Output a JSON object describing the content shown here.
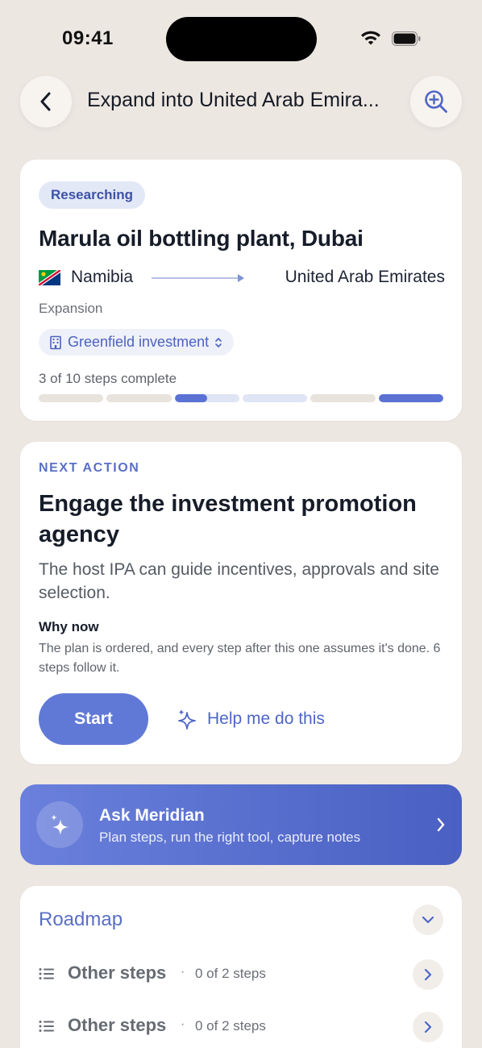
{
  "status_bar": {
    "time": "09:41"
  },
  "header": {
    "title": "Expand into United Arab Emira..."
  },
  "project": {
    "status_badge": "Researching",
    "title": "Marula oil bottling plant, Dubai",
    "origin": "Namibia",
    "destination": "United Arab Emirates",
    "type": "Expansion",
    "mode": "Greenfield investment",
    "progress_label": "3 of 10 steps complete",
    "progress": {
      "completed": 3,
      "total": 10
    }
  },
  "next_action": {
    "eyebrow": "NEXT ACTION",
    "title": "Engage the investment promotion agency",
    "description": "The host IPA can guide incentives, approvals and site selection.",
    "why_label": "Why now",
    "why_text": "The plan is ordered, and every step after this one assumes it's done. 6 steps follow it.",
    "start_label": "Start",
    "help_label": "Help me do this"
  },
  "assistant": {
    "title": "Ask Meridian",
    "subtitle": "Plan steps, run the right tool, capture notes"
  },
  "roadmap": {
    "title": "Roadmap",
    "rows": [
      {
        "label": "Other steps",
        "count": "0 of 2 steps"
      },
      {
        "label": "Other steps",
        "count": "0 of 2 steps"
      }
    ]
  },
  "colors": {
    "accent": "#5b72d4",
    "background": "#ede7e2",
    "badge_bg": "#e3e8f7"
  }
}
